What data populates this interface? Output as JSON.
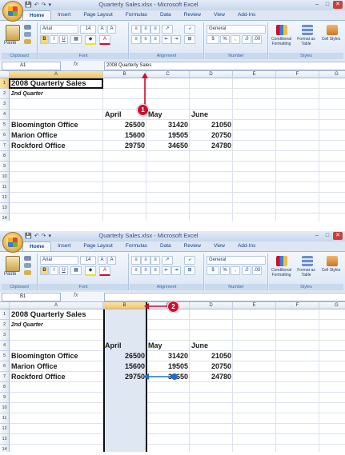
{
  "window": {
    "title": "Quarterly Sales.xlsx - Microsoft Excel",
    "controls": [
      "–",
      "□",
      "✕"
    ]
  },
  "quick_access": [
    "💾",
    "↶",
    "↷",
    "▾"
  ],
  "ribbon": {
    "tabs": [
      "Home",
      "Insert",
      "Page Layout",
      "Formulas",
      "Data",
      "Review",
      "View",
      "Add-Ins"
    ],
    "active_tab": "Home",
    "paste_label": "Paste",
    "font_name": "Arial",
    "font_size": "14",
    "number_format": "General",
    "styles": [
      "Conditional Formatting",
      "Format as Table",
      "Cell Styles"
    ],
    "groups": [
      "Clipboard",
      "Font",
      "Alignment",
      "Number",
      "Styles"
    ]
  },
  "panels": [
    {
      "namebox": "A1",
      "formula": "2008 Quarterly Sales",
      "callout": "1"
    },
    {
      "namebox": "B1",
      "formula": "",
      "callout": "2"
    }
  ],
  "sheet": {
    "columns": [
      "A",
      "B",
      "C",
      "D",
      "E",
      "F",
      "G"
    ],
    "rows": [
      "1",
      "2",
      "3",
      "4",
      "5",
      "6",
      "7",
      "8",
      "9",
      "10",
      "11",
      "12",
      "13",
      "14"
    ],
    "title": "2008 Quarterly Sales",
    "subtitle": "2nd Quarter",
    "month_headers": [
      "April",
      "May",
      "June"
    ],
    "data": [
      {
        "label": "Bloomington Office",
        "values": [
          "26500",
          "31420",
          "21050"
        ]
      },
      {
        "label": "Marion Office",
        "values": [
          "15600",
          "19505",
          "20750"
        ]
      },
      {
        "label": "Rockford Office",
        "values": [
          "29750",
          "34650",
          "24780"
        ]
      }
    ]
  },
  "colors": {
    "ribbon_blue": "#dde6f2",
    "selection_header": "#f2c56b",
    "callout_red": "#c8102e",
    "arrow_red": "#c8102e",
    "arrow_blue": "#1f6fc8"
  }
}
